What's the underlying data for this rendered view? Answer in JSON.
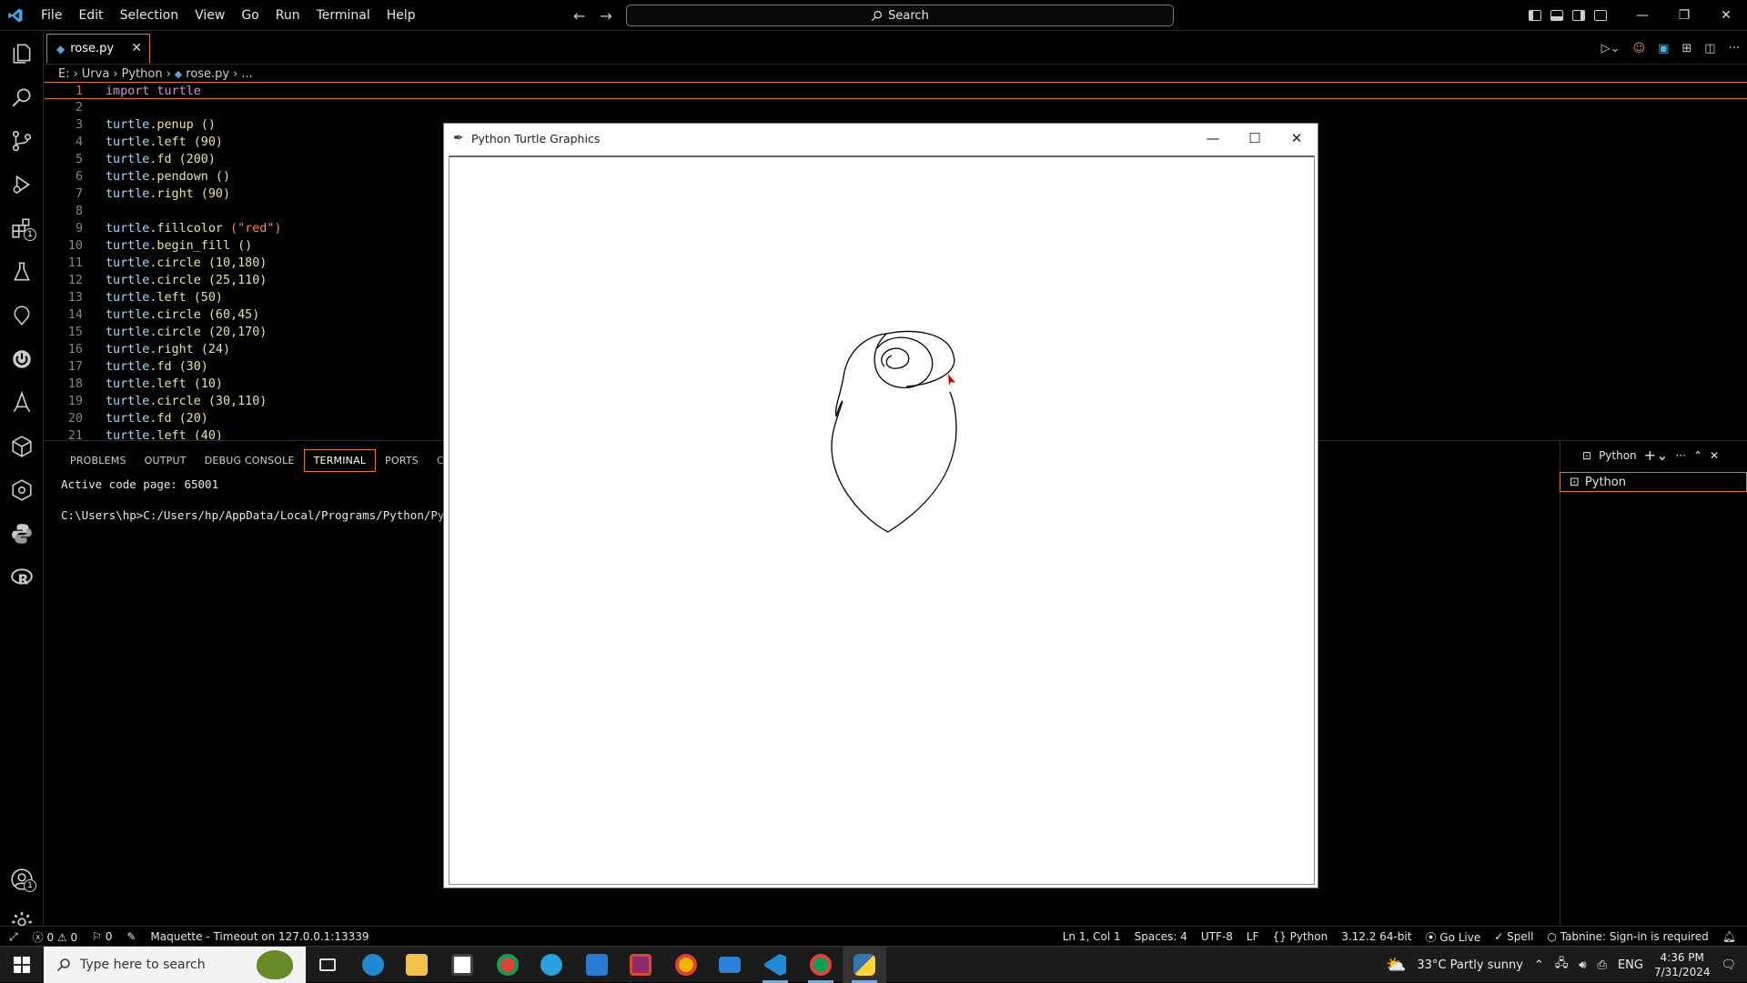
{
  "titlebar": {
    "menus": [
      "File",
      "Edit",
      "Selection",
      "View",
      "Go",
      "Run",
      "Terminal",
      "Help"
    ],
    "search_label": "Search"
  },
  "tab": {
    "filename": "rose.py"
  },
  "breadcrumb": [
    "E:",
    "Urva",
    "Python",
    "rose.py",
    "..."
  ],
  "editor": {
    "lines": [
      {
        "n": "1",
        "code": "import turtle"
      },
      {
        "n": "2",
        "code": ""
      },
      {
        "n": "3",
        "code": "turtle.penup ()"
      },
      {
        "n": "4",
        "code": "turtle.left (90)"
      },
      {
        "n": "5",
        "code": "turtle.fd (200)"
      },
      {
        "n": "6",
        "code": "turtle.pendown ()"
      },
      {
        "n": "7",
        "code": "turtle.right (90)"
      },
      {
        "n": "8",
        "code": ""
      },
      {
        "n": "9",
        "code": "turtle.fillcolor (\"red\")"
      },
      {
        "n": "10",
        "code": "turtle.begin_fill ()"
      },
      {
        "n": "11",
        "code": "turtle.circle (10,180)"
      },
      {
        "n": "12",
        "code": "turtle.circle (25,110)"
      },
      {
        "n": "13",
        "code": "turtle.left (50)"
      },
      {
        "n": "14",
        "code": "turtle.circle (60,45)"
      },
      {
        "n": "15",
        "code": "turtle.circle (20,170)"
      },
      {
        "n": "16",
        "code": "turtle.right (24)"
      },
      {
        "n": "17",
        "code": "turtle.fd (30)"
      },
      {
        "n": "18",
        "code": "turtle.left (10)"
      },
      {
        "n": "19",
        "code": "turtle.circle (30,110)"
      },
      {
        "n": "20",
        "code": "turtle.fd (20)"
      },
      {
        "n": "21",
        "code": "turtle.left (40)"
      }
    ]
  },
  "panel": {
    "tabs": [
      "PROBLEMS",
      "OUTPUT",
      "DEBUG CONSOLE",
      "TERMINAL",
      "PORTS",
      "COMM"
    ],
    "active_tab": "TERMINAL",
    "terminal_lines": [
      "Active code page: 65001",
      "C:\\Users\\hp>C:/Users/hp/AppData/Local/Programs/Python/Python"
    ],
    "terminal_name": "Python",
    "terminal_list_item": "Python"
  },
  "turtle_window": {
    "title": "Python Turtle Graphics"
  },
  "statusbar": {
    "errors": "0",
    "warnings": "0",
    "ports": "0",
    "maquette": "Maquette - Timeout on 127.0.0.1:13339",
    "position": "Ln 1, Col 1",
    "spaces": "Spaces: 4",
    "encoding": "UTF-8",
    "eol": "LF",
    "language": "Python",
    "interpreter": "3.12.2 64-bit",
    "golive": "Go Live",
    "spell": "Spell",
    "tabnine": "Tabnine: Sign-in is required"
  },
  "taskbar": {
    "search_placeholder": "Type here to search",
    "weather": "33°C  Partly sunny",
    "lang": "ENG",
    "time": "4:36 PM",
    "date": "7/31/2024"
  },
  "activity_badges": {
    "extensions": "1",
    "accounts": "1"
  }
}
